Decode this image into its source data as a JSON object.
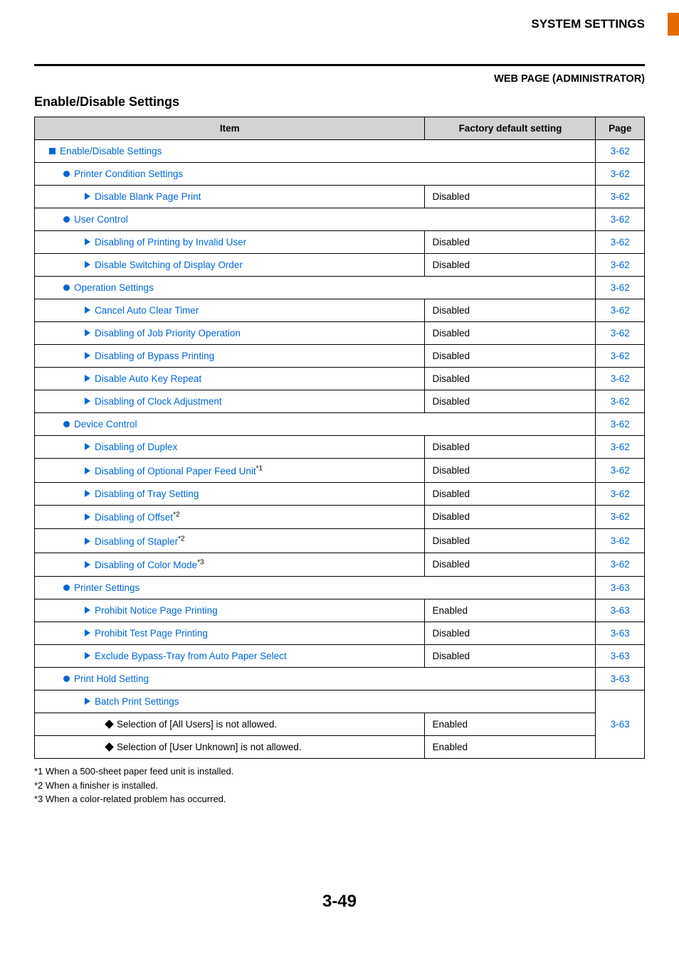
{
  "header": {
    "system": "SYSTEM SETTINGS",
    "sub": "WEB PAGE (ADMINISTRATOR)"
  },
  "section_title": "Enable/Disable Settings",
  "columns": {
    "item": "Item",
    "factory": "Factory default setting",
    "page": "Page"
  },
  "rows": [
    {
      "kind": "span",
      "marker": "sq",
      "indent": 1,
      "link": true,
      "label": "Enable/Disable Settings",
      "page": "3-62"
    },
    {
      "kind": "span",
      "marker": "dot",
      "indent": 2,
      "link": true,
      "label": "Printer Condition Settings",
      "page": "3-62"
    },
    {
      "kind": "row",
      "marker": "tri",
      "indent": 3,
      "link": true,
      "label": "Disable Blank Page Print",
      "value": "Disabled",
      "page": "3-62"
    },
    {
      "kind": "span",
      "marker": "dot",
      "indent": 2,
      "link": true,
      "label": "User Control",
      "page": "3-62"
    },
    {
      "kind": "row",
      "marker": "tri",
      "indent": 3,
      "link": true,
      "label": "Disabling of Printing by Invalid User",
      "value": "Disabled",
      "page": "3-62"
    },
    {
      "kind": "row",
      "marker": "tri",
      "indent": 3,
      "link": true,
      "label": "Disable Switching of Display Order",
      "value": "Disabled",
      "page": "3-62"
    },
    {
      "kind": "span",
      "marker": "dot",
      "indent": 2,
      "link": true,
      "label": "Operation Settings",
      "page": "3-62"
    },
    {
      "kind": "row",
      "marker": "tri",
      "indent": 3,
      "link": true,
      "label": "Cancel Auto Clear Timer",
      "value": "Disabled",
      "page": "3-62"
    },
    {
      "kind": "row",
      "marker": "tri",
      "indent": 3,
      "link": true,
      "label": "Disabling of Job Priority Operation",
      "value": "Disabled",
      "page": "3-62"
    },
    {
      "kind": "row",
      "marker": "tri",
      "indent": 3,
      "link": true,
      "label": "Disabling of Bypass Printing",
      "value": "Disabled",
      "page": "3-62"
    },
    {
      "kind": "row",
      "marker": "tri",
      "indent": 3,
      "link": true,
      "label": "Disable Auto Key Repeat",
      "value": "Disabled",
      "page": "3-62"
    },
    {
      "kind": "row",
      "marker": "tri",
      "indent": 3,
      "link": true,
      "label": "Disabling of Clock Adjustment",
      "value": "Disabled",
      "page": "3-62"
    },
    {
      "kind": "span",
      "marker": "dot",
      "indent": 2,
      "link": true,
      "label": "Device Control",
      "page": "3-62"
    },
    {
      "kind": "row",
      "marker": "tri",
      "indent": 3,
      "link": true,
      "label": "Disabling of Duplex",
      "value": "Disabled",
      "page": "3-62"
    },
    {
      "kind": "row",
      "marker": "tri",
      "indent": 3,
      "link": true,
      "label": "Disabling of Optional Paper Feed Unit",
      "sup": "*1",
      "value": "Disabled",
      "page": "3-62"
    },
    {
      "kind": "row",
      "marker": "tri",
      "indent": 3,
      "link": true,
      "label": "Disabling of Tray Setting",
      "value": "Disabled",
      "page": "3-62"
    },
    {
      "kind": "row",
      "marker": "tri",
      "indent": 3,
      "link": true,
      "label": "Disabling of Offset",
      "sup": "*2",
      "value": "Disabled",
      "page": "3-62"
    },
    {
      "kind": "row",
      "marker": "tri",
      "indent": 3,
      "link": true,
      "label": "Disabling of Stapler",
      "sup": "*2",
      "value": "Disabled",
      "page": "3-62"
    },
    {
      "kind": "row",
      "marker": "tri",
      "indent": 3,
      "link": true,
      "label": "Disabling of Color Mode",
      "sup": "*3",
      "value": "Disabled",
      "page": "3-62"
    },
    {
      "kind": "span",
      "marker": "dot",
      "indent": 2,
      "link": true,
      "label": "Printer Settings",
      "page": "3-63"
    },
    {
      "kind": "row",
      "marker": "tri",
      "indent": 3,
      "link": true,
      "label": "Prohibit Notice Page Printing",
      "value": "Enabled",
      "page": "3-63"
    },
    {
      "kind": "row",
      "marker": "tri",
      "indent": 3,
      "link": true,
      "label": "Prohibit Test Page Printing",
      "value": "Disabled",
      "page": "3-63"
    },
    {
      "kind": "row",
      "marker": "tri",
      "indent": 3,
      "link": true,
      "label": "Exclude Bypass-Tray from Auto Paper Select",
      "value": "Disabled",
      "page": "3-63"
    },
    {
      "kind": "span",
      "marker": "dot",
      "indent": 2,
      "link": true,
      "label": "Print Hold Setting",
      "page": "3-63"
    },
    {
      "kind": "span_nopage",
      "marker": "tri",
      "indent": 3,
      "link": true,
      "label": "Batch Print Settings"
    },
    {
      "kind": "row_grouped",
      "marker": "dia",
      "indent": 4,
      "link": false,
      "label": "Selection of [All Users] is not allowed.",
      "value": "Enabled",
      "page": "3-63",
      "rowspan_page": 2
    },
    {
      "kind": "row_tail",
      "marker": "dia",
      "indent": 4,
      "link": false,
      "label": "Selection of [User Unknown] is not allowed.",
      "value": "Enabled"
    }
  ],
  "footnotes": [
    "*1  When a 500-sheet paper feed unit is installed.",
    "*2  When a finisher is installed.",
    "*3  When a color-related problem has occurred."
  ],
  "page_number": "3-49"
}
